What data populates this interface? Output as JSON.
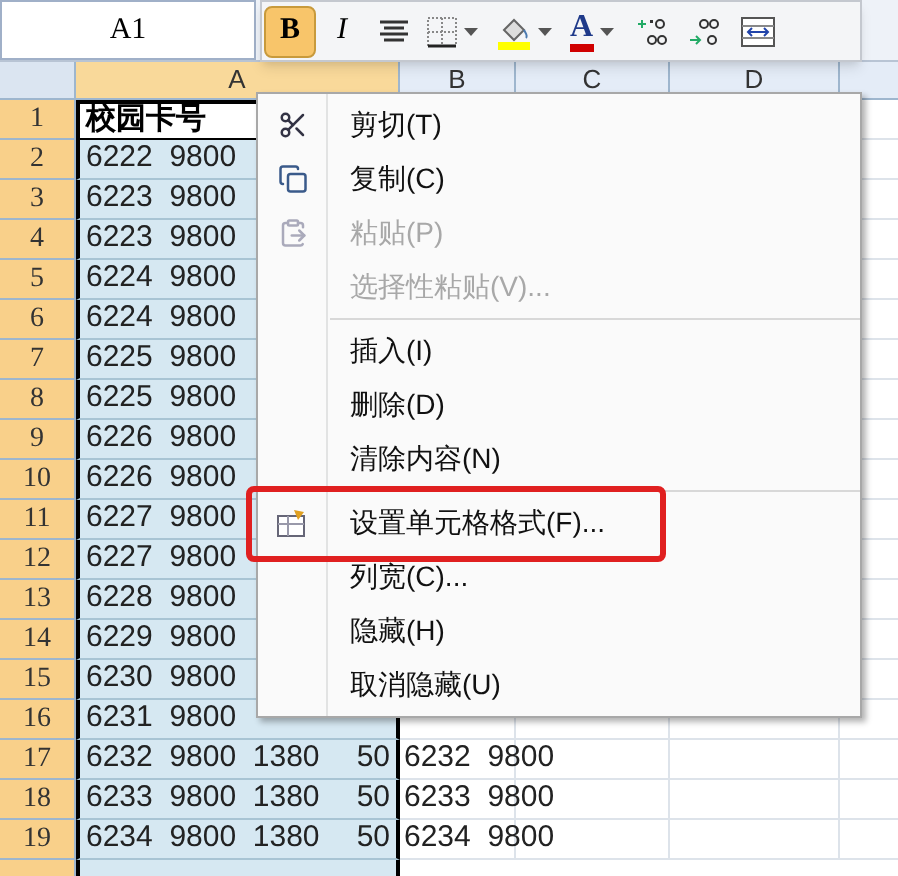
{
  "name_box": "A1",
  "toolbar": [
    {
      "kind": "bold",
      "label": "B",
      "selected": true
    },
    {
      "kind": "italic",
      "label": "I",
      "selected": false
    },
    {
      "kind": "align"
    },
    {
      "kind": "borders"
    },
    {
      "kind": "fill"
    },
    {
      "kind": "font_color",
      "label": "A"
    },
    {
      "kind": "increase_decimal"
    },
    {
      "kind": "decrease_decimal"
    },
    {
      "kind": "merge"
    }
  ],
  "columns": [
    "A",
    "B",
    "C",
    "D"
  ],
  "rows": [
    {
      "number": "1",
      "selected": true,
      "active": true,
      "cells": [
        "校园卡号"
      ]
    },
    {
      "number": "2",
      "selected": true,
      "active": false,
      "cells": [
        "6222  9800"
      ]
    },
    {
      "number": "3",
      "selected": true,
      "active": false,
      "cells": [
        "6223  9800"
      ]
    },
    {
      "number": "4",
      "selected": true,
      "active": false,
      "cells": [
        "6223  9800"
      ]
    },
    {
      "number": "5",
      "selected": true,
      "active": false,
      "cells": [
        "6224  9800"
      ]
    },
    {
      "number": "6",
      "selected": true,
      "active": false,
      "cells": [
        "6224  9800"
      ]
    },
    {
      "number": "7",
      "selected": true,
      "active": false,
      "cells": [
        "6225  9800"
      ]
    },
    {
      "number": "8",
      "selected": true,
      "active": false,
      "cells": [
        "6225  9800"
      ]
    },
    {
      "number": "9",
      "selected": true,
      "active": false,
      "cells": [
        "6226  9800"
      ]
    },
    {
      "number": "10",
      "selected": true,
      "active": false,
      "cells": [
        "6226  9800"
      ]
    },
    {
      "number": "11",
      "selected": true,
      "active": false,
      "cells": [
        "6227  9800"
      ]
    },
    {
      "number": "12",
      "selected": true,
      "active": false,
      "cells": [
        "6227  9800"
      ]
    },
    {
      "number": "13",
      "selected": true,
      "active": false,
      "cells": [
        "6228  9800"
      ]
    },
    {
      "number": "14",
      "selected": true,
      "active": false,
      "cells": [
        "6229  9800"
      ]
    },
    {
      "number": "15",
      "selected": true,
      "active": false,
      "cells": [
        "6230  9800"
      ]
    },
    {
      "number": "16",
      "selected": true,
      "active": false,
      "cells": [
        "6231  9800"
      ]
    },
    {
      "number": "17",
      "selected": true,
      "active": false,
      "cells": [
        "6232  9800  1380",
        "50",
        "6232  9800"
      ]
    },
    {
      "number": "18",
      "selected": true,
      "active": false,
      "cells": [
        "6233  9800  1380",
        "50",
        "6233  9800"
      ]
    },
    {
      "number": "19",
      "selected": true,
      "active": false,
      "cells": [
        "6234  9800  1380",
        "50",
        "6234  9800"
      ]
    }
  ],
  "context_menu": [
    {
      "kind": "item",
      "label": "剪切(T)",
      "disabled": false,
      "outlined": false
    },
    {
      "kind": "item",
      "label": "复制(C)",
      "disabled": false,
      "outlined": false
    },
    {
      "kind": "item",
      "label": "粘贴(P)",
      "disabled": true,
      "outlined": false
    },
    {
      "kind": "item",
      "label": "选择性粘贴(V)...",
      "disabled": true,
      "outlined": false
    },
    {
      "kind": "separator"
    },
    {
      "kind": "item",
      "label": "插入(I)",
      "disabled": false,
      "outlined": false
    },
    {
      "kind": "item",
      "label": "删除(D)",
      "disabled": false,
      "outlined": false
    },
    {
      "kind": "item",
      "label": "清除内容(N)",
      "disabled": false,
      "outlined": false
    },
    {
      "kind": "separator"
    },
    {
      "kind": "item",
      "label": "设置单元格格式(F)...",
      "disabled": false,
      "outlined": true
    },
    {
      "kind": "item",
      "label": "列宽(C)...",
      "disabled": false,
      "outlined": false
    },
    {
      "kind": "item",
      "label": "隐藏(H)",
      "disabled": false,
      "outlined": false
    },
    {
      "kind": "item",
      "label": "取消隐藏(U)",
      "disabled": false,
      "outlined": false
    }
  ]
}
